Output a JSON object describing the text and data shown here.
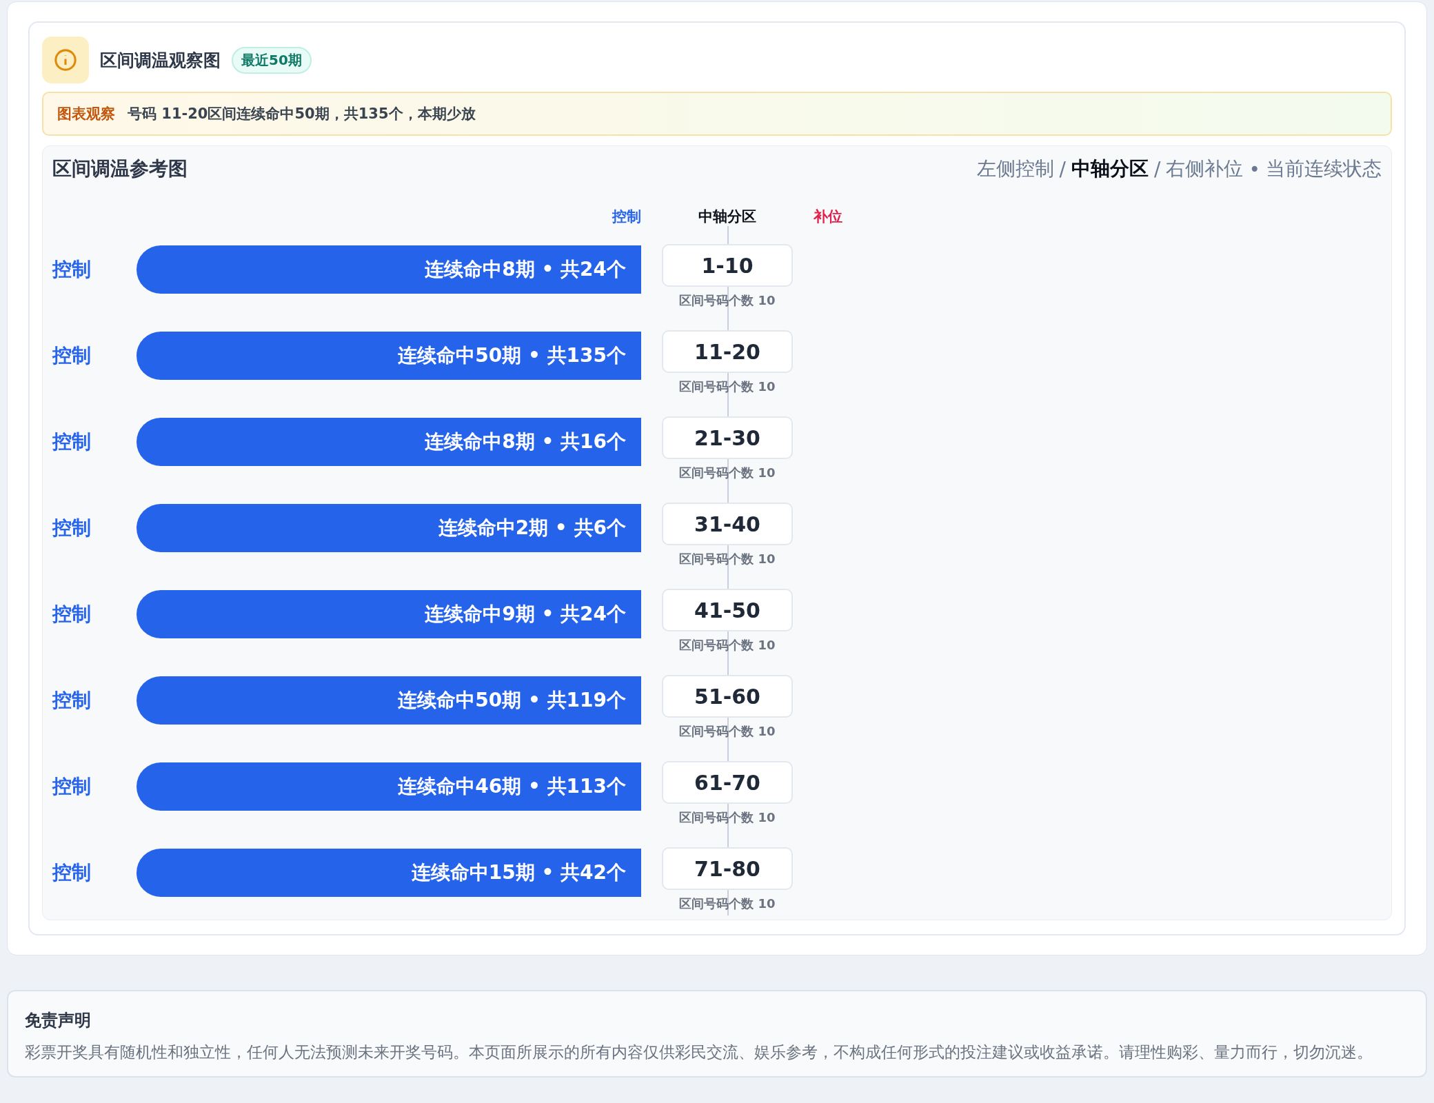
{
  "header": {
    "title": "区间调温观察图",
    "badge": "最近50期"
  },
  "notice": {
    "label": "图表观察",
    "text": "号码 11-20区间连续命中50期，共135个，本期少放"
  },
  "chart": {
    "title": "区间调温参考图",
    "legend": [
      {
        "text": "左侧控制",
        "selected": false
      },
      {
        "text": "中轴分区",
        "selected": true
      },
      {
        "text": "右侧补位",
        "selected": false
      }
    ],
    "legend_separator": "/",
    "legend_dot": "•",
    "legend_note": "当前连续状态",
    "columns": {
      "left": "控制",
      "center": "中轴分区",
      "right": "补位"
    },
    "rows": [
      {
        "side": "控制",
        "bar": "连续命中8期 • 共24个",
        "range": "1-10",
        "note": "区间号码个数 10"
      },
      {
        "side": "控制",
        "bar": "连续命中50期 • 共135个",
        "range": "11-20",
        "note": "区间号码个数 10"
      },
      {
        "side": "控制",
        "bar": "连续命中8期 • 共16个",
        "range": "21-30",
        "note": "区间号码个数 10"
      },
      {
        "side": "控制",
        "bar": "连续命中2期 • 共6个",
        "range": "31-40",
        "note": "区间号码个数 10"
      },
      {
        "side": "控制",
        "bar": "连续命中9期 • 共24个",
        "range": "41-50",
        "note": "区间号码个数 10"
      },
      {
        "side": "控制",
        "bar": "连续命中50期 • 共119个",
        "range": "51-60",
        "note": "区间号码个数 10"
      },
      {
        "side": "控制",
        "bar": "连续命中46期 • 共113个",
        "range": "61-70",
        "note": "区间号码个数 10"
      },
      {
        "side": "控制",
        "bar": "连续命中15期 • 共42个",
        "range": "71-80",
        "note": "区间号码个数 10"
      }
    ]
  },
  "disclaimer": {
    "title": "免责声明",
    "text": "彩票开奖具有随机性和独立性，任何人无法预测未来开奖号码。本页面所展示的所有内容仅供彩民交流、娱乐参考，不构成任何形式的投注建议或收益承诺。请理性购彩、量力而行，切勿沉迷。"
  }
}
